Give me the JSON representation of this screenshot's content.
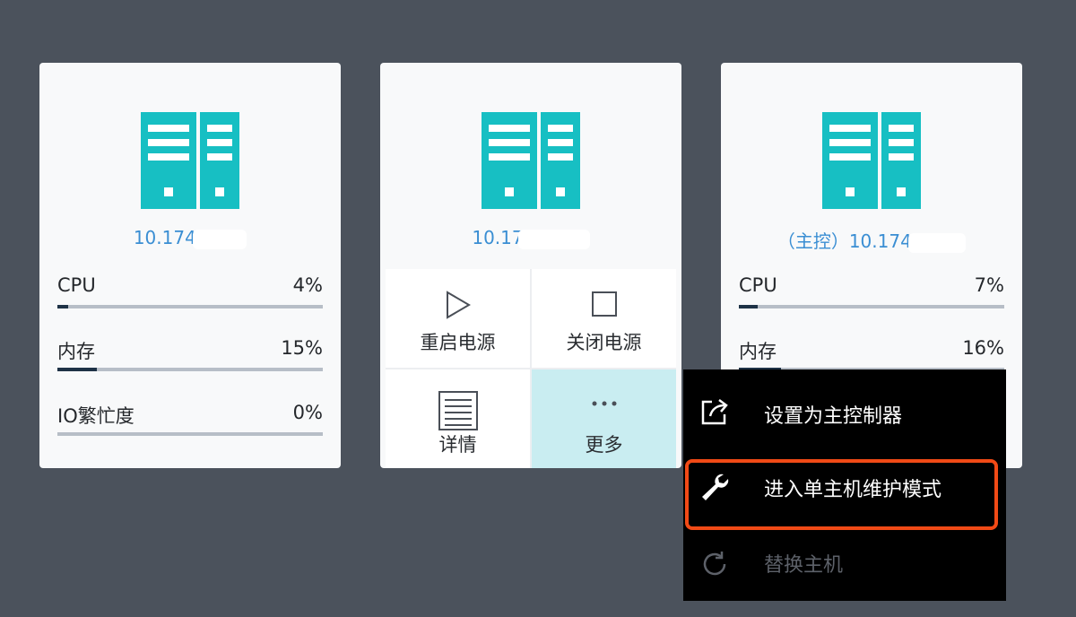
{
  "colors": {
    "background": "#4b525c",
    "card": "#f8f9fa",
    "server_icon": "#17bfc3",
    "ip_text": "#3a8ed3",
    "progress_fill": "#1e3246",
    "progress_track": "#b7bec7",
    "highlight_tile": "#c9edf1",
    "menu_bg": "#000000",
    "annotation": "#f14a16"
  },
  "hosts": [
    {
      "ip": "10.174.",
      "metrics": [
        {
          "label": "CPU",
          "value": "4%",
          "fraction": 0.04
        },
        {
          "label": "内存",
          "value": "15%",
          "fraction": 0.15
        },
        {
          "label": "IO繁忙度",
          "value": "0%",
          "fraction": 0.0
        }
      ]
    },
    {
      "ip": "10.17",
      "actions": [
        {
          "label": "重启电源",
          "icon": "play-icon"
        },
        {
          "label": "关闭电源",
          "icon": "stop-icon"
        },
        {
          "label": "详情",
          "icon": "document-icon"
        },
        {
          "label": "更多",
          "icon": "more-icon"
        }
      ]
    },
    {
      "ip": "（主控）10.174.",
      "metrics": [
        {
          "label": "CPU",
          "value": "7%",
          "fraction": 0.07
        },
        {
          "label": "内存",
          "value": "16%",
          "fraction": 0.16
        }
      ]
    }
  ],
  "menu": {
    "items": [
      {
        "label": "设置为主控制器",
        "icon": "external-link-icon",
        "enabled": true
      },
      {
        "label": "进入单主机维护模式",
        "icon": "wrench-icon",
        "enabled": true
      },
      {
        "label": "替换主机",
        "icon": "refresh-icon",
        "enabled": false
      }
    ]
  }
}
